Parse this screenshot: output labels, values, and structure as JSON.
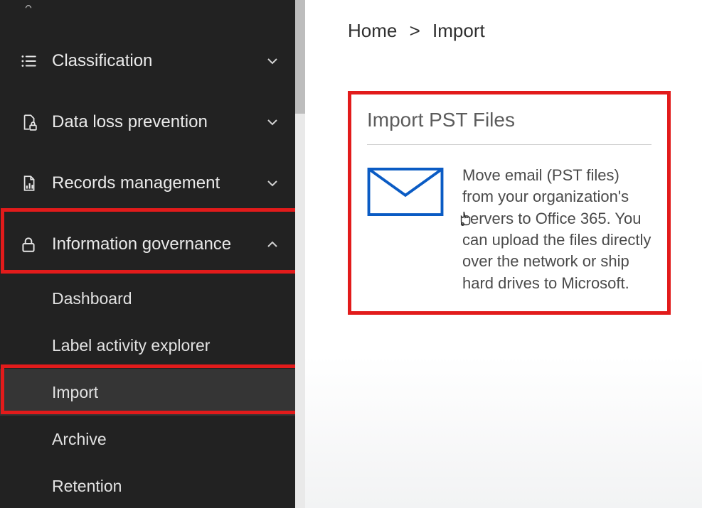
{
  "sidebar": {
    "items": [
      {
        "label": "Classification"
      },
      {
        "label": "Data loss prevention"
      },
      {
        "label": "Records management"
      },
      {
        "label": "Information governance"
      }
    ],
    "sub": [
      {
        "label": "Dashboard"
      },
      {
        "label": "Label activity explorer"
      },
      {
        "label": "Import"
      },
      {
        "label": "Archive"
      },
      {
        "label": "Retention"
      }
    ]
  },
  "breadcrumb": {
    "home": "Home",
    "sep": ">",
    "current": "Import"
  },
  "card": {
    "title": "Import PST Files",
    "body": "Move email (PST files) from your organization's servers to Office 365. You can upload the files directly over the network or ship hard drives to Microsoft."
  }
}
